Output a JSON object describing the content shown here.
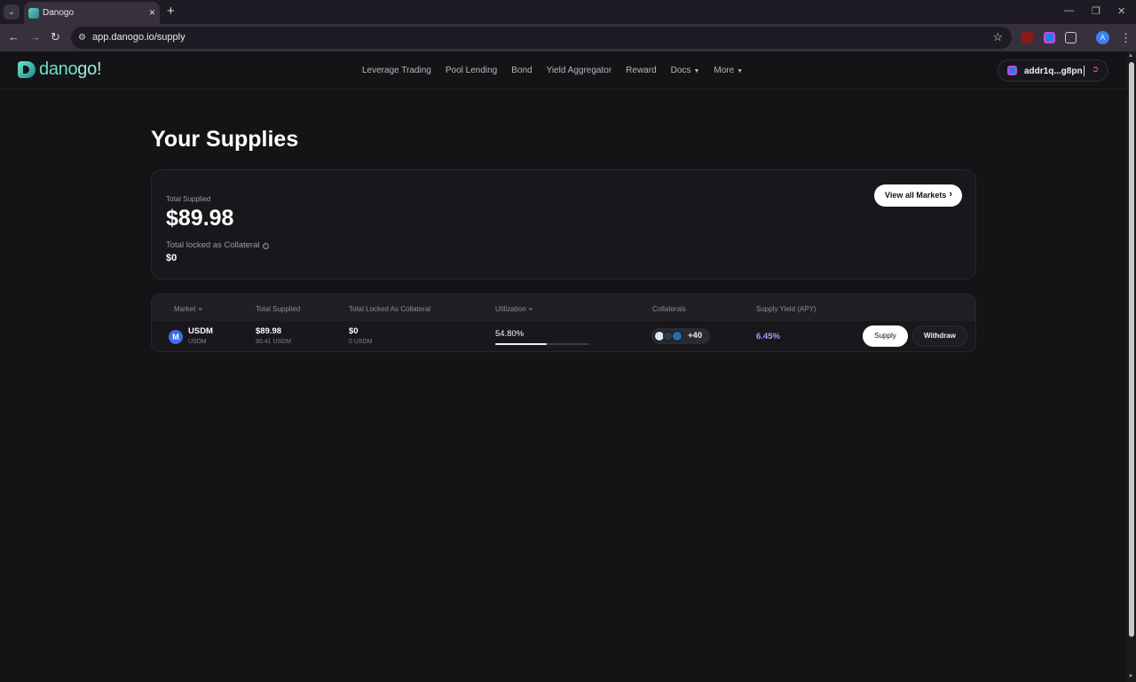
{
  "browser": {
    "tab_title": "Danogo",
    "url": "app.danogo.io/supply",
    "profile_initial": "A",
    "extension_badge": "1"
  },
  "header": {
    "logo": {
      "part1": "dano",
      "part2": "go!"
    },
    "nav": [
      {
        "label": "Leverage Trading"
      },
      {
        "label": "Pool Lending"
      },
      {
        "label": "Bond"
      },
      {
        "label": "Yield Aggregator"
      },
      {
        "label": "Reward"
      },
      {
        "label": "Docs",
        "dropdown": true
      },
      {
        "label": "More",
        "dropdown": true
      }
    ],
    "wallet_address": "addr1q...g8pn"
  },
  "page": {
    "title": "Your Supplies",
    "summary": {
      "total_supplied_label": "Total Supplied",
      "total_supplied_value": "$89.98",
      "collateral_label": "Total locked as Collateral",
      "collateral_value": "$0",
      "view_markets_label": "View all Markets"
    },
    "table": {
      "headers": {
        "market": "Market",
        "total_supplied": "Total Supplied",
        "total_locked": "Total Locked As Collateral",
        "utilization": "Utilization",
        "collaterals": "Collaterals",
        "supply_yield": "Supply Yield (APY)"
      },
      "rows": [
        {
          "icon_letter": "M",
          "market": "USDM",
          "market_sub": "USDM",
          "total_supplied": "$89.98",
          "total_supplied_sub": "90.41 USDM",
          "total_locked": "$0",
          "total_locked_sub": "0 USDM",
          "utilization": "54.80%",
          "utilization_fraction": 0.548,
          "collaterals_more": "+40",
          "apy": "6.45%",
          "supply_label": "Supply",
          "withdraw_label": "Withdraw"
        }
      ]
    }
  },
  "colors": {
    "background": "#141417",
    "card": "#18181c",
    "brand": "#6fdfc8",
    "apy": "#a89cff",
    "token": "#3b6df0"
  }
}
